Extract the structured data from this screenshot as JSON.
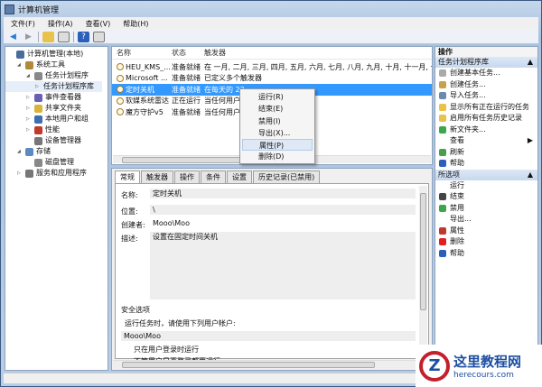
{
  "title": "计算机管理",
  "menu": [
    "文件(F)",
    "操作(A)",
    "查看(V)",
    "帮助(H)"
  ],
  "tree": [
    {
      "label": "计算机管理(本地)",
      "indent": 0,
      "color": "#4a6c9b"
    },
    {
      "label": "系统工具",
      "indent": 1,
      "color": "#b08a3a"
    },
    {
      "label": "任务计划程序",
      "indent": 2,
      "color": "#888"
    },
    {
      "label": "任务计划程序库",
      "indent": 3,
      "color": "",
      "selected": true
    },
    {
      "label": "事件查看器",
      "indent": 2,
      "color": "#6b5fb5"
    },
    {
      "label": "共享文件夹",
      "indent": 2,
      "color": "#d9b43a"
    },
    {
      "label": "本地用户和组",
      "indent": 2,
      "color": "#3b6fb0"
    },
    {
      "label": "性能",
      "indent": 2,
      "color": "#c0392b"
    },
    {
      "label": "设备管理器",
      "indent": 2,
      "color": "#777"
    },
    {
      "label": "存储",
      "indent": 1,
      "color": "#5b8bc0"
    },
    {
      "label": "磁盘管理",
      "indent": 2,
      "color": "#888"
    },
    {
      "label": "服务和应用程序",
      "indent": 1,
      "color": "#777"
    }
  ],
  "list": {
    "headers": [
      "名称",
      "状态",
      "触发器"
    ],
    "rows": [
      {
        "name": "HEU_KMS_...",
        "status": "准备就绪",
        "trigger": "在 一月, 二月, 三月, 四月, 五月, 六月, 七月, 八月, 九月, 十月, 十一月, 十二月 的"
      },
      {
        "name": "Microsoft ...",
        "status": "准备就绪",
        "trigger": "已定义多个触发器"
      },
      {
        "name": "定时关机",
        "status": "准备就绪",
        "trigger": "在每天的 23",
        "selected": true
      },
      {
        "name": "软媒系统雷达",
        "status": "正在运行",
        "trigger": "当任何用户登"
      },
      {
        "name": "魔方守护v5",
        "status": "准备就绪",
        "trigger": "当任何用户登"
      }
    ]
  },
  "context_menu": [
    "运行(R)",
    "结束(E)",
    "禁用(I)",
    "导出(X)...",
    "属性(P)",
    "删除(D)"
  ],
  "tabs": [
    "常规",
    "触发器",
    "操作",
    "条件",
    "设置",
    "历史记录(已禁用)"
  ],
  "general": {
    "name_label": "名称:",
    "name": "定时关机",
    "location_label": "位置:",
    "location": "\\",
    "author_label": "创建者:",
    "author": "Mooo\\Moo",
    "desc_label": "描述:",
    "desc": "设置在固定时间关机",
    "security_title": "安全选项",
    "run_as_text": "运行任务时，请使用下列用户帐户:",
    "account": "Mooo\\Moo",
    "option1": "只在用户登录时运行",
    "option2": "不管用户是否登录都要运行"
  },
  "actions": {
    "header": "操作",
    "section1": "任务计划程序库",
    "items1": [
      {
        "label": "创建基本任务...",
        "color": "#aaa"
      },
      {
        "label": "创建任务...",
        "color": "#c8a24a"
      },
      {
        "label": "导入任务...",
        "color": "#6a8ab0"
      },
      {
        "label": "显示所有正在运行的任务",
        "color": "#e8c24a"
      },
      {
        "label": "启用所有任务历史记录",
        "color": "#e8c24a"
      },
      {
        "label": "新文件夹...",
        "color": "#3aa84a"
      },
      {
        "label": "查看",
        "color": "",
        "arrow": "▶"
      },
      {
        "label": "刷新",
        "color": "#4aa04a"
      },
      {
        "label": "帮助",
        "color": "#2b5fb8"
      }
    ],
    "section2": "所选项",
    "items2": [
      {
        "label": "运行",
        "color": ""
      },
      {
        "label": "结束",
        "color": "#444"
      },
      {
        "label": "禁用",
        "color": "#3aa84a"
      },
      {
        "label": "导出...",
        "color": ""
      },
      {
        "label": "属性",
        "color": "#c0392b"
      },
      {
        "label": "删除",
        "color": "#e02020"
      },
      {
        "label": "帮助",
        "color": "#2b5fb8"
      }
    ]
  },
  "watermark": {
    "name": "这里教程网",
    "url": "herecours.com"
  }
}
